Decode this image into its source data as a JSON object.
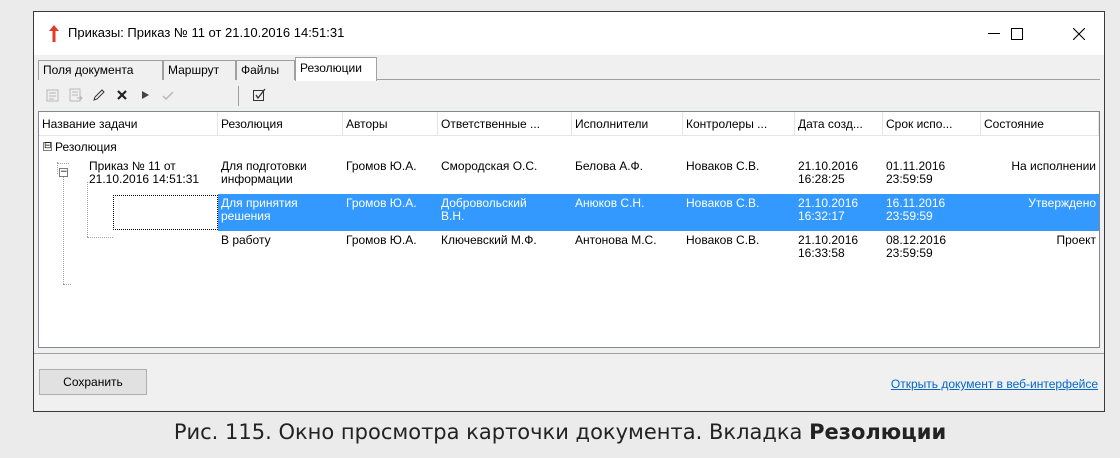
{
  "window": {
    "title": "Приказы: Приказ № 11 от 21.10.2016 14:51:31",
    "icon": "red-arrow-up-icon",
    "controls": [
      "minimize-icon",
      "maximize-icon",
      "close-icon"
    ]
  },
  "tabs": [
    {
      "label": "Поля документа",
      "active": false
    },
    {
      "label": "Маршрут",
      "active": false
    },
    {
      "label": "Файлы",
      "active": false
    },
    {
      "label": "Резолюции",
      "active": true
    }
  ],
  "toolbar": {
    "icons": [
      "add-resolution-icon",
      "copy-resolution-icon",
      "edit-pencil-icon",
      "delete-x-icon",
      "play-icon",
      "approve-check-icon",
      "checkbox-edit-icon"
    ]
  },
  "grid": {
    "columns": [
      "Название задачи",
      "Резолюция",
      "Авторы",
      "Ответственные ...",
      "Исполнители",
      "Контролеры ...",
      "Дата созд...",
      "Срок испо...",
      "Состояние"
    ],
    "group": {
      "label": "Резолюция",
      "expander": "⊟"
    },
    "rows": [
      {
        "task": "Приказ № 11 от\n21.10.2016 14:51:31",
        "resolution": "Для подготовки\nинформации",
        "authors": "Громов Ю.А.",
        "responsible": "Смородская О.С.",
        "executors": "Белова А.Ф.",
        "controllers": "Новаков С.В.",
        "created": "21.10.2016\n16:28:25",
        "deadline": "01.11.2016\n23:59:59",
        "state": "На исполнении",
        "selected": false
      },
      {
        "task": "",
        "resolution": "Для принятия\nрешения",
        "authors": "Громов Ю.А.",
        "responsible": "Добровольский\nВ.Н.",
        "executors": "Анюков С.Н.",
        "controllers": "Новаков С.В.",
        "created": "21.10.2016\n16:32:17",
        "deadline": "16.11.2016\n23:59:59",
        "state": "Утверждено",
        "selected": true
      },
      {
        "task": "",
        "resolution": "В работу",
        "authors": "Громов Ю.А.",
        "responsible": "Ключевский М.Ф.",
        "executors": "Антонова М.С.",
        "controllers": "Новаков С.В.",
        "created": "21.10.2016\n16:33:58",
        "deadline": "08.12.2016\n23:59:59",
        "state": "Проект",
        "selected": false
      }
    ]
  },
  "footer": {
    "save_label": "Сохранить",
    "web_link": "Открыть документ в веб-интерфейсе"
  },
  "caption": {
    "prefix": "Рис. 115. Окно просмотра карточки документа. Вкладка ",
    "bold": "Резолюции"
  },
  "colors": {
    "selection": "#3399ff",
    "link": "#0066cc",
    "app_icon": "#e03c28"
  }
}
